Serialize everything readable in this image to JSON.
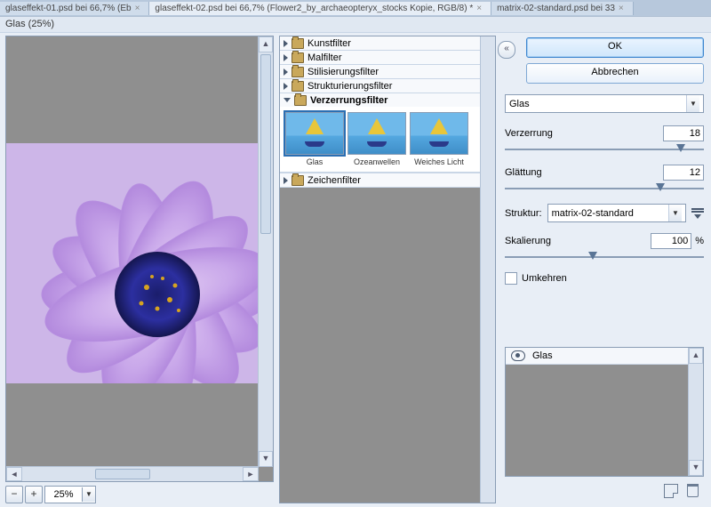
{
  "tabs": [
    {
      "label": "glaseffekt-01.psd bei 66,7% (Eb"
    },
    {
      "label": "glaseffekt-02.psd bei 66,7% (Flower2_by_archaeopteryx_stocks Kopie, RGB/8) *"
    },
    {
      "label": "matrix-02-standard.psd bei 33"
    }
  ],
  "dialog_title": "Glas (25%)",
  "zoom": "25%",
  "categories": {
    "kunst": "Kunstfilter",
    "mal": "Malfilter",
    "stil": "Stilisierungsfilter",
    "struktur": "Strukturierungsfilter",
    "verzerr": "Verzerrungsfilter",
    "zeichen": "Zeichenfilter"
  },
  "thumbs": {
    "glas": "Glas",
    "ozean": "Ozeanwellen",
    "weiches": "Weiches Licht"
  },
  "buttons": {
    "ok": "OK",
    "cancel": "Abbrechen"
  },
  "filter_select": "Glas",
  "params": {
    "verzerrung": {
      "label": "Verzerrung",
      "value": "18"
    },
    "glaettung": {
      "label": "Glättung",
      "value": "12"
    },
    "struktur": {
      "label": "Struktur:",
      "value": "matrix-02-standard"
    },
    "skalierung": {
      "label": "Skalierung",
      "value": "100",
      "pct": "%"
    },
    "umkehren": "Umkehren"
  },
  "stack": {
    "row0": "Glas"
  }
}
